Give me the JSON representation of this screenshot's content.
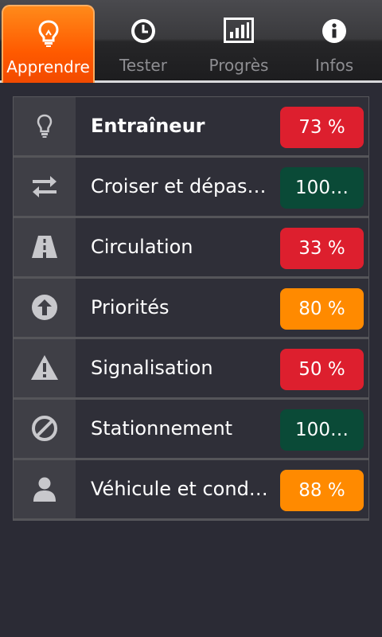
{
  "tabs": [
    {
      "label": "Apprendre",
      "icon": "bulb-icon",
      "active": true
    },
    {
      "label": "Tester",
      "icon": "clock-icon",
      "active": false
    },
    {
      "label": "Progrès",
      "icon": "bar-chart-icon",
      "active": false
    },
    {
      "label": "Infos",
      "icon": "info-icon",
      "active": false
    }
  ],
  "colors": {
    "red": "#dd1f2e",
    "green": "#0a4a37",
    "orange": "#ff8a00",
    "accent": "#ff6a00"
  },
  "categories": [
    {
      "label": "Entraîneur",
      "score": "73 %",
      "status": "red",
      "icon": "bulb-icon"
    },
    {
      "label": "Croiser et dépas…",
      "score": "100…",
      "status": "green",
      "icon": "swap-arrows-icon"
    },
    {
      "label": "Circulation",
      "score": "33 %",
      "status": "red",
      "icon": "road-icon"
    },
    {
      "label": "Priorités",
      "score": "80 %",
      "status": "orange",
      "icon": "up-arrow-circle-icon"
    },
    {
      "label": "Signalisation",
      "score": "50 %",
      "status": "red",
      "icon": "warning-icon"
    },
    {
      "label": "Stationnement",
      "score": "100…",
      "status": "green",
      "icon": "no-entry-icon"
    },
    {
      "label": "Véhicule et cond…",
      "score": "88 %",
      "status": "orange",
      "icon": "person-icon"
    }
  ]
}
